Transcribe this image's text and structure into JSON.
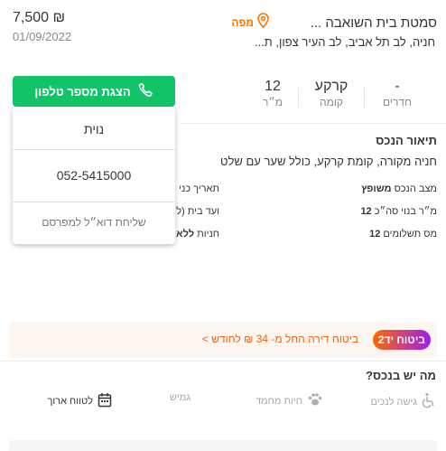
{
  "listing": {
    "title": "סמטת בית השואבה ...",
    "map_label": "מפה",
    "subtitle": "חניה, לב תל אביב, לב העיר צפון, ת...",
    "price": "7,500 ₪",
    "date": "01/09/2022"
  },
  "stats": [
    {
      "value": "-",
      "label": "חדרים"
    },
    {
      "value": "קרקע",
      "label": "קומה"
    },
    {
      "value": "12",
      "label": "מ״ר"
    }
  ],
  "contact": {
    "button_label": "הצגת מספר טלפון",
    "name": "נוית",
    "phone": "052-5415000",
    "email_label": "שליחת דוא״ל למפרסם"
  },
  "description": {
    "title": "תיאור הנכס",
    "text": "חניה מקורה, קומת קרקע, כולל שער עם שלט"
  },
  "details": {
    "condition_label": "מצב הנכס",
    "condition_value": "משופץ",
    "sqm_label": "מ״ר בנוי סה״כ",
    "sqm_value": "12",
    "payments_label": "מס תשלומים",
    "payments_value": "12",
    "entry_label": "תאריך כני",
    "committee_label": "ועד בית (ל",
    "parking_label": "חניות",
    "parking_value": "ללא"
  },
  "insurance": {
    "badge": "ביטוח יד2",
    "text": "ביטוח דירה החל מ- 34 ₪ לחודש >"
  },
  "amenities": {
    "title": "מה יש בנכס?",
    "items": [
      {
        "label": "גישה לנכים",
        "icon": "wheelchair-icon",
        "active": false
      },
      {
        "label": "חיות מחמד",
        "icon": "paw-icon",
        "active": false
      },
      {
        "label": "גמיש",
        "icon": "flexible-icon",
        "active": false
      },
      {
        "label": "לטווח ארוך",
        "icon": "calendar-icon",
        "active": true
      }
    ]
  },
  "colors": {
    "accent_green": "#12c467",
    "accent_orange": "#ff7100",
    "insurance_bg": "#fdf5ef"
  }
}
